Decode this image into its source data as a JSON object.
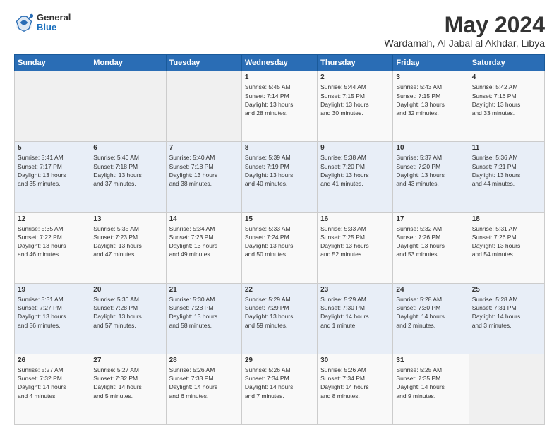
{
  "header": {
    "logo_general": "General",
    "logo_blue": "Blue",
    "month_title": "May 2024",
    "location": "Wardamah, Al Jabal al Akhdar, Libya"
  },
  "days_header": [
    "Sunday",
    "Monday",
    "Tuesday",
    "Wednesday",
    "Thursday",
    "Friday",
    "Saturday"
  ],
  "weeks": [
    [
      {
        "day": "",
        "info": ""
      },
      {
        "day": "",
        "info": ""
      },
      {
        "day": "",
        "info": ""
      },
      {
        "day": "1",
        "info": "Sunrise: 5:45 AM\nSunset: 7:14 PM\nDaylight: 13 hours\nand 28 minutes."
      },
      {
        "day": "2",
        "info": "Sunrise: 5:44 AM\nSunset: 7:15 PM\nDaylight: 13 hours\nand 30 minutes."
      },
      {
        "day": "3",
        "info": "Sunrise: 5:43 AM\nSunset: 7:15 PM\nDaylight: 13 hours\nand 32 minutes."
      },
      {
        "day": "4",
        "info": "Sunrise: 5:42 AM\nSunset: 7:16 PM\nDaylight: 13 hours\nand 33 minutes."
      }
    ],
    [
      {
        "day": "5",
        "info": "Sunrise: 5:41 AM\nSunset: 7:17 PM\nDaylight: 13 hours\nand 35 minutes."
      },
      {
        "day": "6",
        "info": "Sunrise: 5:40 AM\nSunset: 7:18 PM\nDaylight: 13 hours\nand 37 minutes."
      },
      {
        "day": "7",
        "info": "Sunrise: 5:40 AM\nSunset: 7:18 PM\nDaylight: 13 hours\nand 38 minutes."
      },
      {
        "day": "8",
        "info": "Sunrise: 5:39 AM\nSunset: 7:19 PM\nDaylight: 13 hours\nand 40 minutes."
      },
      {
        "day": "9",
        "info": "Sunrise: 5:38 AM\nSunset: 7:20 PM\nDaylight: 13 hours\nand 41 minutes."
      },
      {
        "day": "10",
        "info": "Sunrise: 5:37 AM\nSunset: 7:20 PM\nDaylight: 13 hours\nand 43 minutes."
      },
      {
        "day": "11",
        "info": "Sunrise: 5:36 AM\nSunset: 7:21 PM\nDaylight: 13 hours\nand 44 minutes."
      }
    ],
    [
      {
        "day": "12",
        "info": "Sunrise: 5:35 AM\nSunset: 7:22 PM\nDaylight: 13 hours\nand 46 minutes."
      },
      {
        "day": "13",
        "info": "Sunrise: 5:35 AM\nSunset: 7:23 PM\nDaylight: 13 hours\nand 47 minutes."
      },
      {
        "day": "14",
        "info": "Sunrise: 5:34 AM\nSunset: 7:23 PM\nDaylight: 13 hours\nand 49 minutes."
      },
      {
        "day": "15",
        "info": "Sunrise: 5:33 AM\nSunset: 7:24 PM\nDaylight: 13 hours\nand 50 minutes."
      },
      {
        "day": "16",
        "info": "Sunrise: 5:33 AM\nSunset: 7:25 PM\nDaylight: 13 hours\nand 52 minutes."
      },
      {
        "day": "17",
        "info": "Sunrise: 5:32 AM\nSunset: 7:26 PM\nDaylight: 13 hours\nand 53 minutes."
      },
      {
        "day": "18",
        "info": "Sunrise: 5:31 AM\nSunset: 7:26 PM\nDaylight: 13 hours\nand 54 minutes."
      }
    ],
    [
      {
        "day": "19",
        "info": "Sunrise: 5:31 AM\nSunset: 7:27 PM\nDaylight: 13 hours\nand 56 minutes."
      },
      {
        "day": "20",
        "info": "Sunrise: 5:30 AM\nSunset: 7:28 PM\nDaylight: 13 hours\nand 57 minutes."
      },
      {
        "day": "21",
        "info": "Sunrise: 5:30 AM\nSunset: 7:28 PM\nDaylight: 13 hours\nand 58 minutes."
      },
      {
        "day": "22",
        "info": "Sunrise: 5:29 AM\nSunset: 7:29 PM\nDaylight: 13 hours\nand 59 minutes."
      },
      {
        "day": "23",
        "info": "Sunrise: 5:29 AM\nSunset: 7:30 PM\nDaylight: 14 hours\nand 1 minute."
      },
      {
        "day": "24",
        "info": "Sunrise: 5:28 AM\nSunset: 7:30 PM\nDaylight: 14 hours\nand 2 minutes."
      },
      {
        "day": "25",
        "info": "Sunrise: 5:28 AM\nSunset: 7:31 PM\nDaylight: 14 hours\nand 3 minutes."
      }
    ],
    [
      {
        "day": "26",
        "info": "Sunrise: 5:27 AM\nSunset: 7:32 PM\nDaylight: 14 hours\nand 4 minutes."
      },
      {
        "day": "27",
        "info": "Sunrise: 5:27 AM\nSunset: 7:32 PM\nDaylight: 14 hours\nand 5 minutes."
      },
      {
        "day": "28",
        "info": "Sunrise: 5:26 AM\nSunset: 7:33 PM\nDaylight: 14 hours\nand 6 minutes."
      },
      {
        "day": "29",
        "info": "Sunrise: 5:26 AM\nSunset: 7:34 PM\nDaylight: 14 hours\nand 7 minutes."
      },
      {
        "day": "30",
        "info": "Sunrise: 5:26 AM\nSunset: 7:34 PM\nDaylight: 14 hours\nand 8 minutes."
      },
      {
        "day": "31",
        "info": "Sunrise: 5:25 AM\nSunset: 7:35 PM\nDaylight: 14 hours\nand 9 minutes."
      },
      {
        "day": "",
        "info": ""
      }
    ]
  ]
}
